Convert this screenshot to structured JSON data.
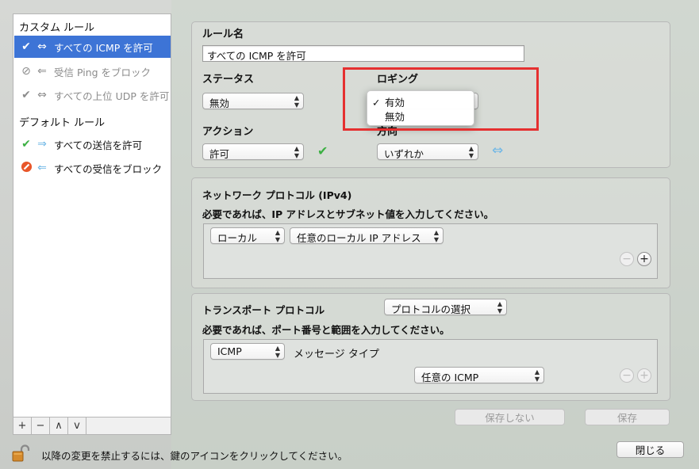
{
  "sidebar": {
    "custom_header": "カスタム ルール",
    "default_header": "デフォルト ルール",
    "custom_items": [
      {
        "label": "すべての ICMP を許可",
        "icon": "check-icon",
        "icon2": "bidirectional-arrow-icon",
        "selected": true
      },
      {
        "label": "受信 Ping をブロック",
        "icon": "block-icon",
        "icon2": "left-arrow-icon",
        "dim": true
      },
      {
        "label": "すべての上位 UDP を許可",
        "icon": "check-icon",
        "icon2": "bidirectional-arrow-icon",
        "dim": true
      }
    ],
    "default_items": [
      {
        "label": "すべての送信を許可",
        "icon": "green-check-icon",
        "icon2": "right-arrow-icon"
      },
      {
        "label": "すべての受信をブロック",
        "icon": "red-block-icon",
        "icon2": "left-arrow-icon"
      }
    ],
    "tools": [
      "+",
      "−",
      "∧",
      "v"
    ]
  },
  "rule": {
    "name_label": "ルール名",
    "name_value": "すべての ICMP を許可",
    "status_label": "ステータス",
    "status_value": "無効",
    "logging_label": "ロギング",
    "logging_menu": [
      "有効",
      "無効"
    ],
    "action_label": "アクション",
    "action_value": "許可",
    "direction_label": "方向",
    "direction_value": "いずれか"
  },
  "network": {
    "title": "ネットワーク プロトコル (IPv4)",
    "subtitle": "必要であれば、IP アドレスとサブネット値を入力してください。",
    "scope_value": "ローカル",
    "address_value": "任意のローカル IP アドレス"
  },
  "transport": {
    "title": "トランスポート プロトコル",
    "protocol_select": "プロトコルの選択",
    "subtitle": "必要であれば、ポート番号と範囲を入力してください。",
    "protocol_value": "ICMP",
    "message_type_label": "メッセージ タイプ",
    "message_type_value": "任意の ICMP"
  },
  "buttons": {
    "dont_save": "保存しない",
    "save": "保存",
    "close": "閉じる"
  },
  "footer": {
    "lock_text": "以降の変更を禁止するには、鍵のアイコンをクリックしてください。"
  },
  "colors": {
    "selection": "#3d74d6",
    "highlight": "#e53030",
    "green": "#3cb043",
    "red": "#e8562a",
    "arrow_blue": "#6fb7e6"
  }
}
